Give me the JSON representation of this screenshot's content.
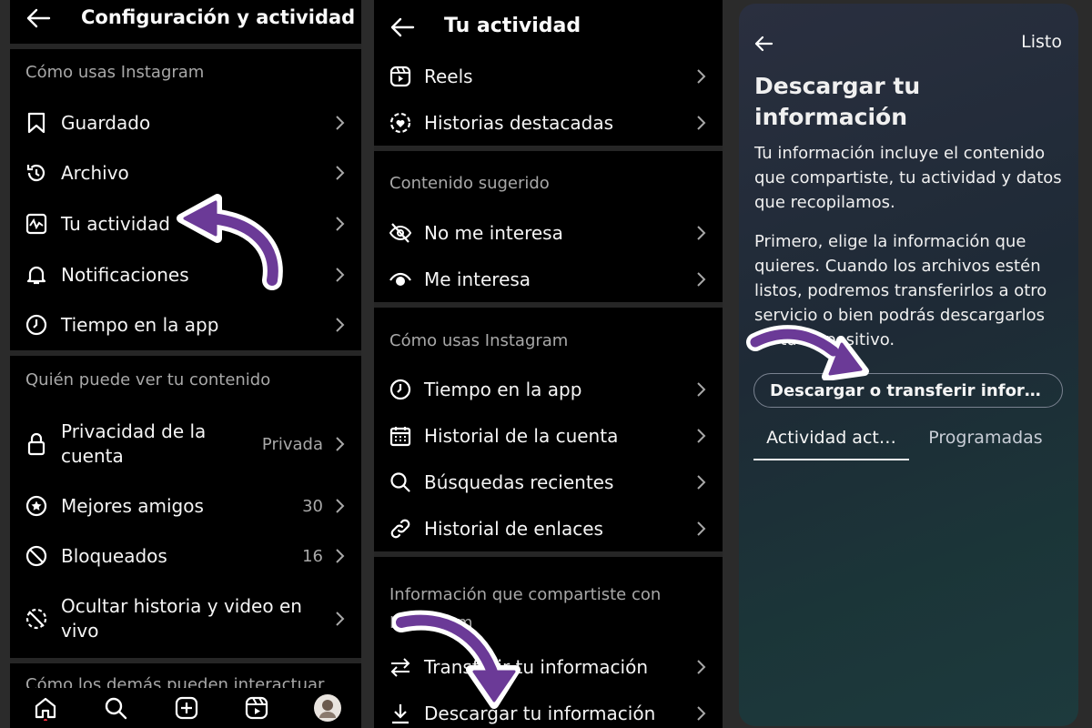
{
  "panel1": {
    "title": "Configuración y actividad",
    "section1": "Cómo usas Instagram",
    "items1": [
      {
        "label": "Guardado"
      },
      {
        "label": "Archivo"
      },
      {
        "label": "Tu actividad"
      },
      {
        "label": "Notificaciones"
      },
      {
        "label": "Tiempo en la app"
      }
    ],
    "section2": "Quién puede ver tu contenido",
    "privacy": {
      "label": "Privacidad de la cuenta",
      "value": "Privada"
    },
    "friends": {
      "label": "Mejores amigos",
      "value": "30"
    },
    "blocked": {
      "label": "Bloqueados",
      "value": "16"
    },
    "hide": {
      "label": "Ocultar historia y video en vivo"
    },
    "section3": "Cómo los demás pueden interactuar"
  },
  "panel2": {
    "title": "Tu actividad",
    "items1": [
      {
        "label": "Reels"
      },
      {
        "label": "Historias destacadas"
      }
    ],
    "section1": "Contenido sugerido",
    "items2": [
      {
        "label": "No me interesa"
      },
      {
        "label": "Me interesa"
      }
    ],
    "section2": "Cómo usas Instagram",
    "items3": [
      {
        "label": "Tiempo en la app"
      },
      {
        "label": "Historial de la cuenta"
      },
      {
        "label": "Búsquedas recientes"
      },
      {
        "label": "Historial de enlaces"
      }
    ],
    "section3": "Información que compartiste con Instagram",
    "items4": [
      {
        "label": "Transferir tu información"
      },
      {
        "label": "Descargar tu información"
      }
    ]
  },
  "panel3": {
    "done": "Listo",
    "title": "Descargar tu información",
    "para1": "Tu información incluye el contenido que compartiste, tu actividad y datos que recopilamos.",
    "para2": "Primero, elige la información que quieres. Cuando los archivos estén listos, podremos transferirlos a otro servicio o bien podrás descargarlos en tu dispositivo.",
    "button": "Descargar o transferir infor…",
    "tabs": [
      "Actividad act…",
      "Programadas"
    ]
  },
  "colors": {
    "arrow": "#6b3a97",
    "bg": "#000000"
  }
}
